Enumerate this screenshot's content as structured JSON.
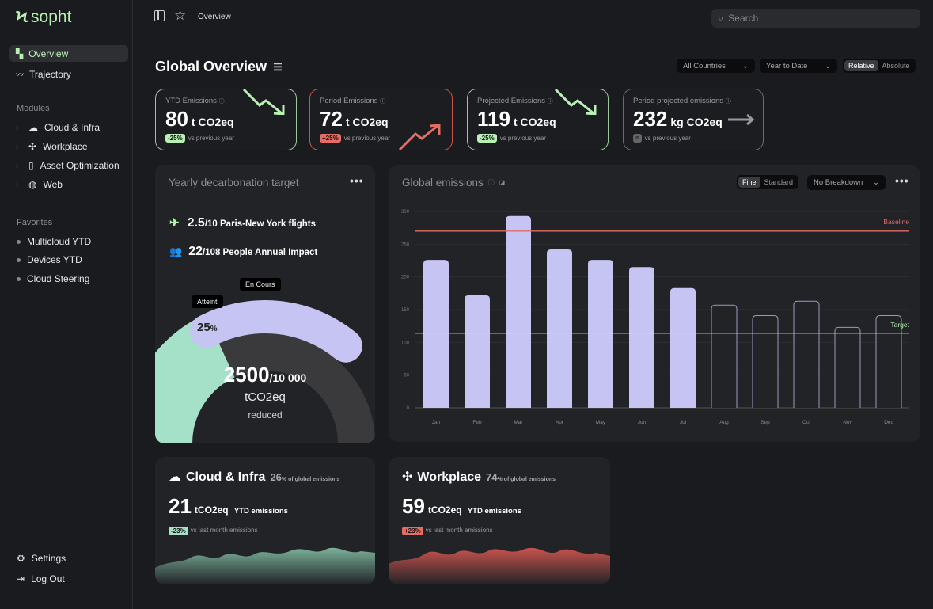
{
  "app": {
    "name": "sopht",
    "accent": "#b9f0b4"
  },
  "sidebar": {
    "nav": [
      {
        "label": "Overview",
        "icon": "grid-icon",
        "active": true
      },
      {
        "label": "Trajectory",
        "icon": "trend-icon"
      }
    ],
    "modules_title": "Modules",
    "modules": [
      {
        "label": "Cloud & Infra",
        "icon": "cloud-icon"
      },
      {
        "label": "Workplace",
        "icon": "workplace-icon"
      },
      {
        "label": "Asset Optimization",
        "icon": "phone-icon"
      },
      {
        "label": "Web",
        "icon": "globe-icon"
      }
    ],
    "favorites_title": "Favorites",
    "favorites": [
      "Multicloud YTD",
      "Devices YTD",
      "Cloud Steering"
    ],
    "settings": "Settings",
    "logout": "Log Out"
  },
  "topbar": {
    "breadcrumb": "Overview",
    "search_placeholder": "Search"
  },
  "page": {
    "title": "Global Overview",
    "filters": {
      "country": "All Countries",
      "period": "Year to Date",
      "modes": [
        "Relative",
        "Absolute"
      ],
      "active_mode": "Relative"
    }
  },
  "kpis": [
    {
      "title": "YTD Emissions",
      "value": "80",
      "unit": "t CO2eq",
      "change": "-25%",
      "note": "vs previous year",
      "trend": "down",
      "color": "#9cc79a"
    },
    {
      "title": "Period Emissions",
      "value": "72",
      "unit": "t CO2eq",
      "change": "+25%",
      "note": "vs previous year",
      "trend": "up",
      "color": "#c9534d"
    },
    {
      "title": "Projected Emissions",
      "value": "119",
      "unit": "t CO2eq",
      "change": "-25%",
      "note": "vs previous year",
      "trend": "down",
      "color": "#9cc79a"
    },
    {
      "title": "Period projected emissions",
      "value": "232",
      "unit": "kg CO2eq",
      "change": "=",
      "note": "vs previous year",
      "trend": "flat",
      "color": "#6a6b70"
    }
  ],
  "decarbonation": {
    "title": "Yearly decarbonation target",
    "flights_value": "2.5",
    "flights_rest": "/10 Paris-New York flights",
    "people_value": "22",
    "people_rest": "/108 People Annual Impact",
    "tip_reached": "Atteint",
    "tip_ongoing": "En Cours",
    "percent": "25",
    "percent_sign": "%",
    "value": "2500",
    "total": "/10 000",
    "unit": "tCO2eq",
    "label": "reduced",
    "progress": 0.25
  },
  "emissions": {
    "title": "Global emissions",
    "granularity": [
      "Fine",
      "Standard"
    ],
    "active_granularity": "Fine",
    "breakdown": "No Breakdown"
  },
  "chart_data": {
    "type": "bar",
    "categories": [
      "Jan",
      "Feb",
      "Mar",
      "Apr",
      "May",
      "Jun",
      "Jul",
      "Aug",
      "Sep",
      "Oct",
      "Nov",
      "Dec"
    ],
    "values": [
      226,
      172,
      293,
      242,
      226,
      215,
      183,
      157,
      141,
      163,
      123,
      141
    ],
    "actual_months": 7,
    "yticks": [
      0,
      50,
      100,
      150,
      200,
      250,
      300
    ],
    "ylim": [
      0,
      300
    ],
    "baseline": {
      "label": "Baseline",
      "value": 270,
      "color": "#e46d66"
    },
    "target": {
      "label": "Target",
      "value": 114,
      "color": "#b9f0b4"
    },
    "bar_color": "#c5c4f2",
    "grid": true
  },
  "cloud": {
    "title": "Cloud & Infra",
    "share": "26",
    "share_label": "% of global emissions",
    "value": "21",
    "unit": "tCO2eq",
    "unit_note": "YTD emissions",
    "change": "-23%",
    "note": "vs last month emissions"
  },
  "workplace": {
    "title": "Workplace",
    "share": "74",
    "share_label": "% of global emissions",
    "value": "59",
    "unit": "tCO2eq",
    "unit_note": "YTD emissions",
    "change": "+23%",
    "note": "vs last month emissions"
  }
}
